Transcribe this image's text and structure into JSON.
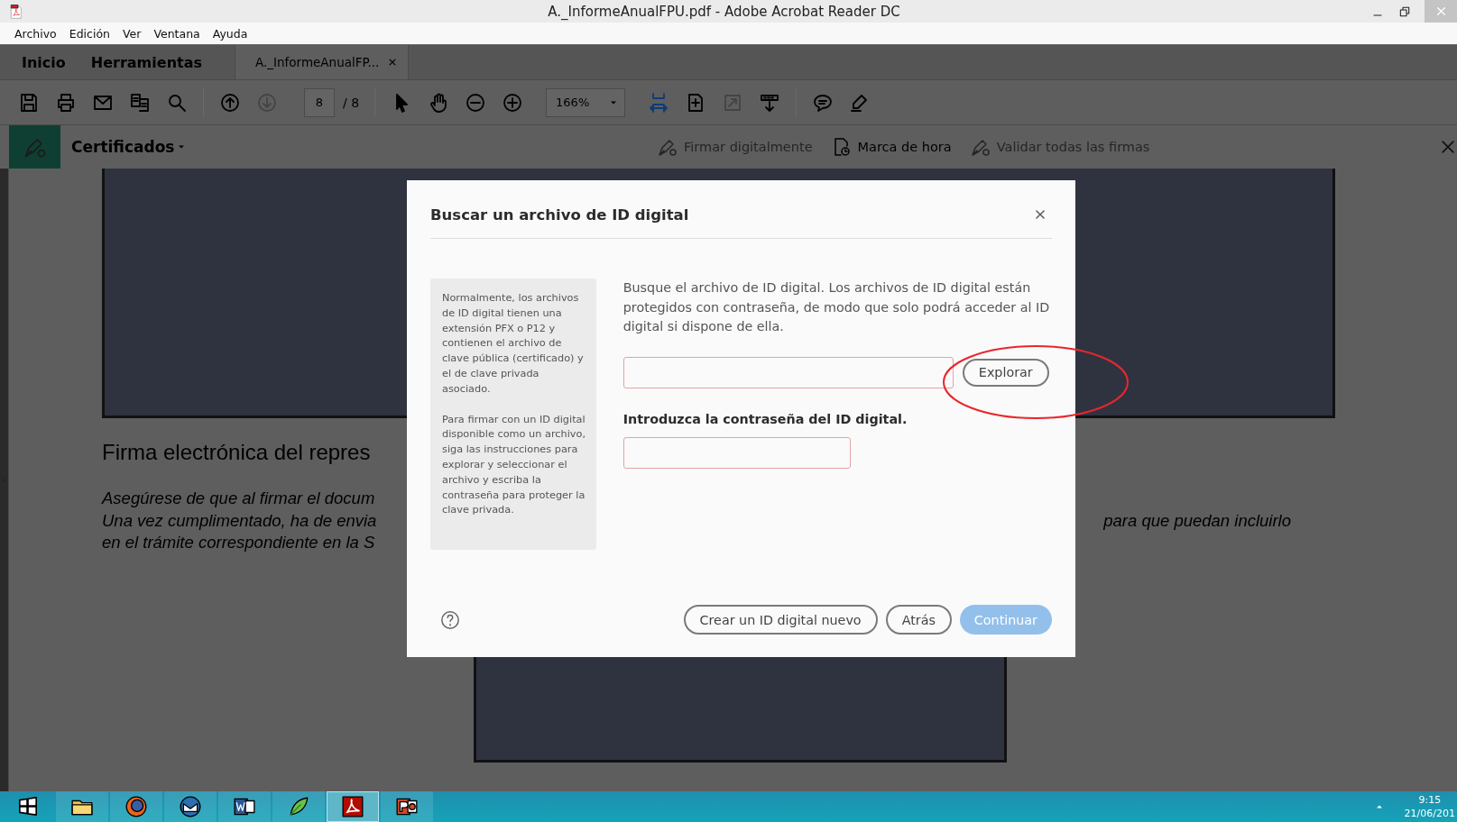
{
  "window": {
    "title": "A._InformeAnualFPU.pdf - Adobe Acrobat Reader DC"
  },
  "menu": [
    "Archivo",
    "Edición",
    "Ver",
    "Ventana",
    "Ayuda"
  ],
  "tabs": [
    {
      "label": "Inicio",
      "selected": false,
      "closable": false
    },
    {
      "label": "Herramientas",
      "selected": false,
      "closable": false
    },
    {
      "label": "A._InformeAnualFP...",
      "selected": true,
      "closable": true
    }
  ],
  "toolbar": [
    {
      "kind": "button",
      "disabled": false,
      "selected": false
    },
    {
      "kind": "button",
      "disabled": false,
      "selected": false
    },
    {
      "kind": "button",
      "disabled": false,
      "selected": false
    },
    {
      "kind": "button",
      "disabled": false,
      "selected": false
    },
    {
      "kind": "button",
      "disabled": false,
      "selected": false
    },
    {
      "kind": "separator"
    },
    {
      "kind": "button",
      "disabled": false,
      "selected": false
    },
    {
      "kind": "button",
      "disabled": true,
      "selected": false
    },
    {
      "kind": "page",
      "value": "8",
      "total": "/ 8"
    },
    {
      "kind": "separator"
    },
    {
      "kind": "button",
      "disabled": false,
      "selected": false
    },
    {
      "kind": "button",
      "disabled": false,
      "selected": false
    },
    {
      "kind": "button",
      "disabled": false,
      "selected": false
    },
    {
      "kind": "button",
      "disabled": false,
      "selected": false
    },
    {
      "kind": "zoom",
      "value": "166%"
    },
    {
      "kind": "button",
      "disabled": false,
      "selected": true
    },
    {
      "kind": "button",
      "disabled": false,
      "selected": false
    },
    {
      "kind": "button",
      "disabled": true,
      "selected": false
    },
    {
      "kind": "button",
      "disabled": false,
      "selected": false
    },
    {
      "kind": "separator"
    },
    {
      "kind": "button",
      "disabled": false,
      "selected": false
    },
    {
      "kind": "button",
      "disabled": false,
      "selected": false
    }
  ],
  "certificates_bar": {
    "title": "Certificados",
    "actions": [
      {
        "label": "Firmar digitalmente",
        "disabled": true
      },
      {
        "label": "Marca de hora",
        "disabled": false
      },
      {
        "label": "Validar todas las firmas",
        "disabled": true
      }
    ]
  },
  "document": {
    "heading": "Firma electrónica del repres",
    "lines": [
      {
        "left": "Asegúrese de que al firmar el docum"
      },
      {
        "left": "Una vez cumplimentado, ha de envia",
        "right": "para que puedan incluirlo"
      },
      {
        "left": "en el trámite correspondiente en la S"
      }
    ]
  },
  "dialog": {
    "title": "Buscar un archivo de ID digital",
    "info": [
      "Normalmente, los archivos de ID digital tienen una extensión PFX o P12 y contienen el archivo de clave pública (certificado) y el de clave privada asociado.",
      "Para firmar con un ID digital disponible como un archivo, siga las instrucciones para explorar y seleccionar el archivo y escriba la contraseña para proteger la clave privada."
    ],
    "description": "Busque el archivo de ID digital. Los archivos de ID digital están protegidos con contraseña, de modo que solo podrá acceder al ID digital si dispone de ella.",
    "browse_button": "Explorar",
    "password_label": "Introduzca la contraseña del ID digital.",
    "buttons": [
      {
        "label": "Crear un ID digital nuevo",
        "kind": "secondary",
        "disabled": false
      },
      {
        "label": "Atrás",
        "kind": "secondary",
        "disabled": false
      },
      {
        "label": "Continuar",
        "kind": "primary",
        "disabled": true
      }
    ]
  },
  "taskbar": {
    "apps": [
      {
        "selected": false
      },
      {
        "selected": false
      },
      {
        "selected": false
      },
      {
        "selected": false
      },
      {
        "selected": false
      },
      {
        "selected": true
      },
      {
        "selected": false
      }
    ],
    "time": "9:15",
    "date": "21/06/201"
  }
}
